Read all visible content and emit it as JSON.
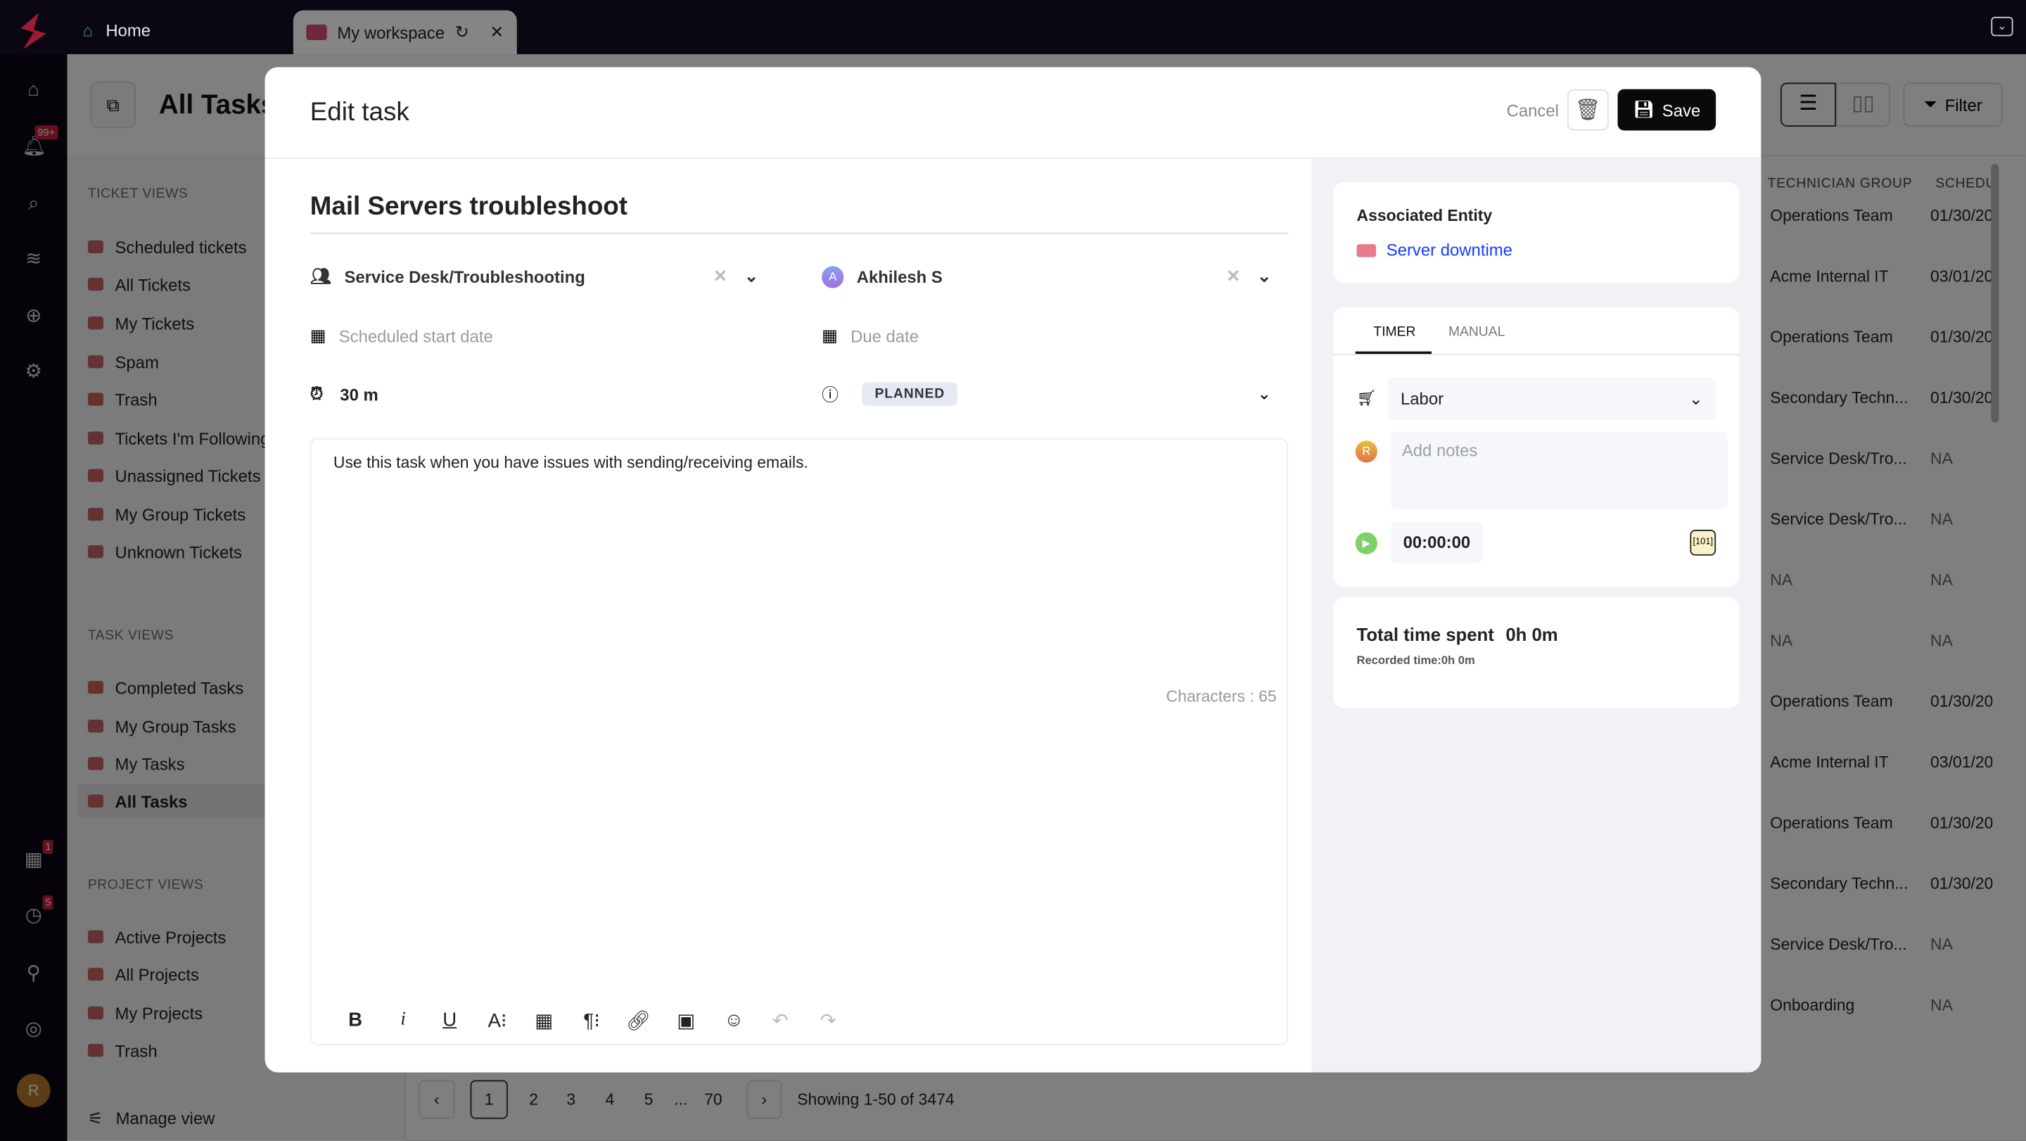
{
  "tabs": {
    "home": "Home",
    "workspace": "My workspace"
  },
  "rail": {
    "notifications_badge": "99+",
    "calendar_badge": "1",
    "timer_badge": "5",
    "avatar": "R"
  },
  "page": {
    "title": "All Tasks",
    "filter": "Filter",
    "manage_view": "Manage view"
  },
  "sidebar": {
    "ticket_views_label": "TICKET VIEWS",
    "ticket_views": [
      "Scheduled tickets",
      "All Tickets",
      "My Tickets",
      "Spam",
      "Trash",
      "Tickets I'm Following",
      "Unassigned Tickets",
      "My Group Tickets",
      "Unknown Tickets"
    ],
    "task_views_label": "TASK VIEWS",
    "task_views": [
      "Completed Tasks",
      "My Group Tasks",
      "My Tasks",
      "All Tasks"
    ],
    "project_views_label": "PROJECT VIEWS",
    "project_views": [
      "Active Projects",
      "All Projects",
      "My Projects",
      "Trash"
    ]
  },
  "table": {
    "headers": [
      "TECHNICIAN GROUP",
      "SCHEDULED"
    ],
    "rows": [
      [
        "Operations Team",
        "01/30/20"
      ],
      [
        "Acme Internal IT",
        "03/01/20"
      ],
      [
        "Operations Team",
        "01/30/20"
      ],
      [
        "Secondary Techn...",
        "01/30/20"
      ],
      [
        "Service Desk/Tro...",
        "NA"
      ],
      [
        "Service Desk/Tro...",
        "NA"
      ],
      [
        "NA",
        "NA"
      ],
      [
        "NA",
        "NA"
      ],
      [
        "Operations Team",
        "01/30/20"
      ],
      [
        "Acme Internal IT",
        "03/01/20"
      ],
      [
        "Operations Team",
        "01/30/20"
      ],
      [
        "Secondary Techn...",
        "01/30/20"
      ],
      [
        "Service Desk/Tro...",
        "NA"
      ],
      [
        "Onboarding",
        "NA"
      ]
    ]
  },
  "pagination": {
    "pages": [
      "1",
      "2",
      "3",
      "4",
      "5",
      "...",
      "70"
    ],
    "current": "1",
    "summary": "Showing 1-50 of 3474"
  },
  "modal": {
    "title": "Edit task",
    "cancel": "Cancel",
    "save": "Save",
    "task_title": "Mail Servers troubleshoot",
    "group": "Service Desk/Troubleshooting",
    "assignee": "Akhilesh S",
    "assignee_initial": "A",
    "start_placeholder": "Scheduled start date",
    "due_placeholder": "Due date",
    "duration": "30 m",
    "status": "PLANNED",
    "description": "Use this task when you have issues with sending/receiving emails.",
    "char_count": "Characters : 65"
  },
  "right": {
    "entity_label": "Associated Entity",
    "entity_link": "Server downtime",
    "tabs": [
      "TIMER",
      "MANUAL"
    ],
    "active_tab": "TIMER",
    "item_type": "Labor",
    "notes_placeholder": "Add notes",
    "user_initial": "R",
    "timer": "00:00:00",
    "total_label": "Total time spent",
    "total_value": "0h 0m",
    "recorded": "Recorded time:0h 0m"
  },
  "colors": {
    "accent": "#0a0a0a",
    "link": "#1a3cff",
    "status_bg": "#e4e9f5",
    "badge": "#c8203c",
    "play": "#7fcf6a"
  }
}
